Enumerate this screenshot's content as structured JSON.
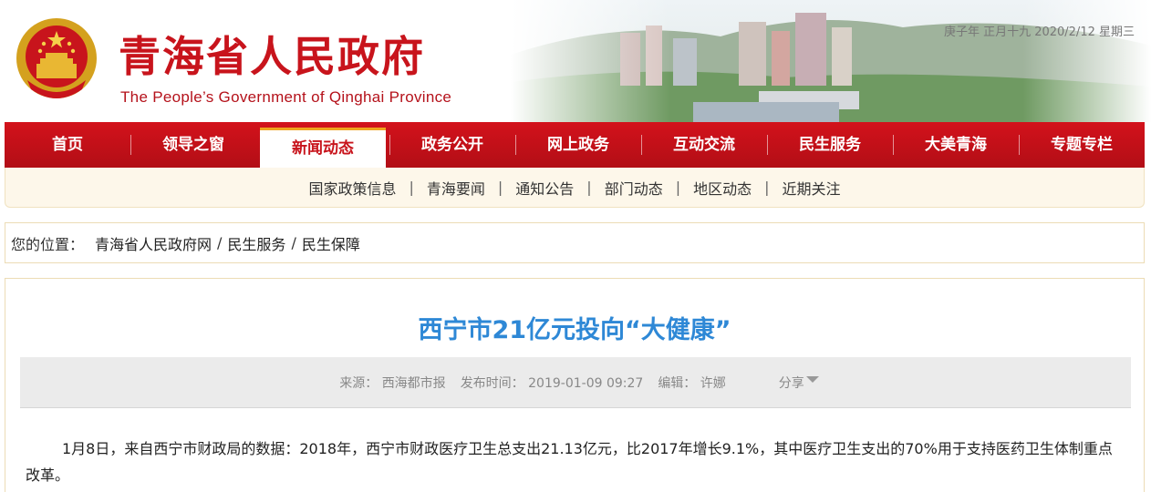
{
  "header": {
    "title_cn": "青海省人民政府",
    "title_en": "The People’s Government of Qinghai Province",
    "date": "庚子年 正月十九 2020/2/12 星期三"
  },
  "nav": {
    "items": [
      {
        "label": "首页"
      },
      {
        "label": "领导之窗"
      },
      {
        "label": "新闻动态",
        "active": true
      },
      {
        "label": "政务公开"
      },
      {
        "label": "网上政务"
      },
      {
        "label": "互动交流"
      },
      {
        "label": "民生服务"
      },
      {
        "label": "大美青海"
      },
      {
        "label": "专题专栏"
      }
    ]
  },
  "subnav": {
    "items": [
      "国家政策信息",
      "青海要闻",
      "通知公告",
      "部门动态",
      "地区动态",
      "近期关注"
    ],
    "separator": "|"
  },
  "breadcrumb": {
    "label": "您的位置：",
    "items": [
      "青海省人民政府网",
      "民生服务",
      "民生保障"
    ],
    "separator": "/"
  },
  "article": {
    "title": "西宁市21亿元投向“大健康”",
    "source_label": "来源：",
    "source": "西海都市报",
    "time_label": "发布时间：",
    "time": "2019-01-09 09:27",
    "editor_label": "编辑：",
    "editor": "许娜",
    "share_label": "分享",
    "body": "1月8日，来自西宁市财政局的数据：2018年，西宁市财政医疗卫生总支出21.13亿元，比2017年增长9.1%，其中医疗卫生支出的70%用于支持医药卫生体制重点改革。"
  },
  "colors": {
    "brand_red": "#c8141c",
    "title_blue": "#2e88d6",
    "active_tab_border": "#f0a31d"
  }
}
